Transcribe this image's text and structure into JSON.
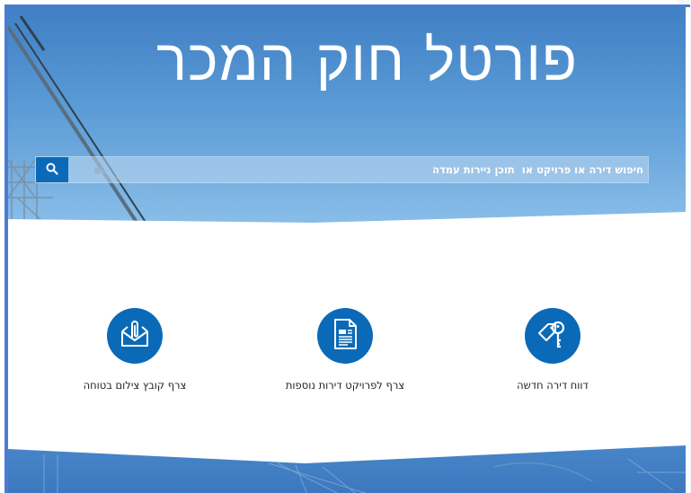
{
  "hero": {
    "title": "פורטל חוק המכר"
  },
  "search": {
    "placeholder": "חיפוש דירה או פרויקט או  תוכן ניירות עמדה",
    "button_icon": "search-icon"
  },
  "actions": [
    {
      "label": "דווח דירה חדשה",
      "icon": "key-icon"
    },
    {
      "label": "צרף לפרויקט דירות נוספות",
      "icon": "document-icon"
    },
    {
      "label": "צרף קובץ צילום בטוחה",
      "icon": "envelope-attachment-icon"
    }
  ],
  "colors": {
    "brand_blue": "#0b6ab8",
    "frame_blue": "#4d7bd1",
    "hero_top": "#3f7fc4",
    "hero_bottom": "#8cc0ea",
    "text": "#222222"
  }
}
